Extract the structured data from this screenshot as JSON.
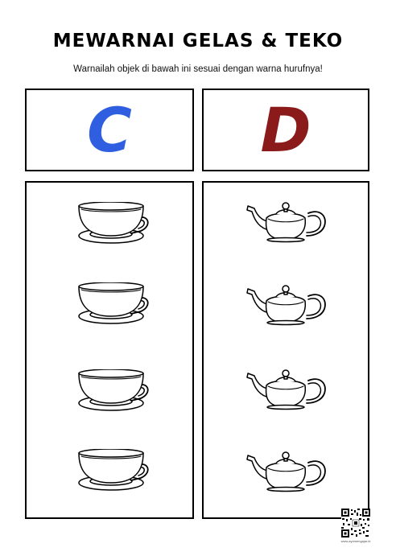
{
  "worksheet": {
    "title": "MEWARNAI GELAS & TEKO",
    "instruction": "Warnailah objek di bawah ini sesuai dengan warna hurufnya!"
  },
  "letters": [
    {
      "char": "C",
      "color": "#2f5fe0"
    },
    {
      "char": "D",
      "color": "#8b1a1a"
    }
  ],
  "columns": [
    {
      "item_icon": "teacup-with-saucer-icon",
      "count": 4
    },
    {
      "item_icon": "teapot-icon",
      "count": 4
    }
  ],
  "footer": {
    "qr_icon": "qr-code-icon",
    "qr_caption": "www.ayomengajar.id"
  }
}
